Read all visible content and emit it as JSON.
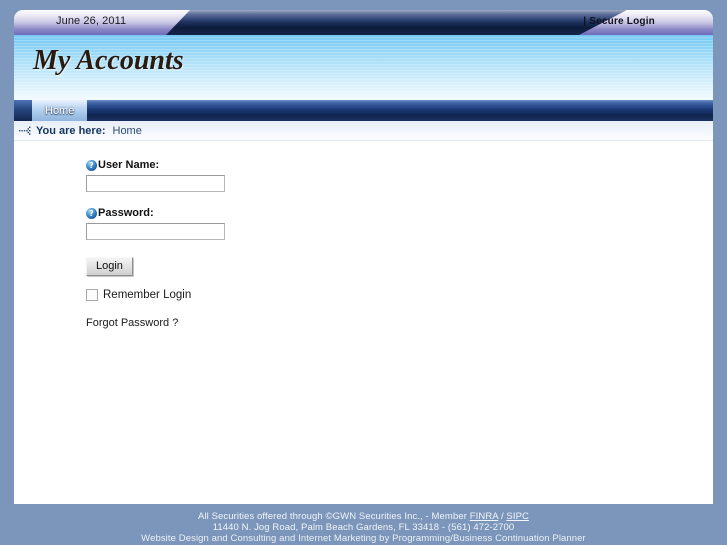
{
  "topbar": {
    "date": "June 26, 2011",
    "secure_login": "| Secure Login"
  },
  "banner": {
    "title": "My Accounts"
  },
  "nav": {
    "tabs": [
      {
        "label": "Home",
        "active": true
      }
    ]
  },
  "breadcrumb": {
    "icon": "breadcrumb-arrow-icon",
    "label": "You are here:",
    "current": "Home"
  },
  "login": {
    "username": {
      "help_icon": "?",
      "label": "User Name:",
      "value": "",
      "placeholder": ""
    },
    "password": {
      "help_icon": "?",
      "label": "Password:",
      "value": "",
      "placeholder": ""
    },
    "login_button": "Login",
    "remember_label": "Remember Login",
    "remember_checked": false,
    "forgot_password": "Forgot Password ?"
  },
  "footer": {
    "line1_pre": "All Securities offered through ©GWN Securities Inc., - Member ",
    "line1_link1": "FINRA",
    "line1_sep": " / ",
    "line1_link2": "SIPC",
    "line2": "11440 N. Jog Road, Palm Beach Gardens, FL 33418 - (561) 472-2700",
    "line3": "Website Design and Consulting and Internet Marketing by Programming/Business Continuation Planner"
  },
  "colors": {
    "page_background": "#7b96ba",
    "nav_dark_blue": "#10254f",
    "banner_blue": "#78c8f2",
    "help_icon_blue": "#1b4f92",
    "content_white": "#ffffff"
  }
}
